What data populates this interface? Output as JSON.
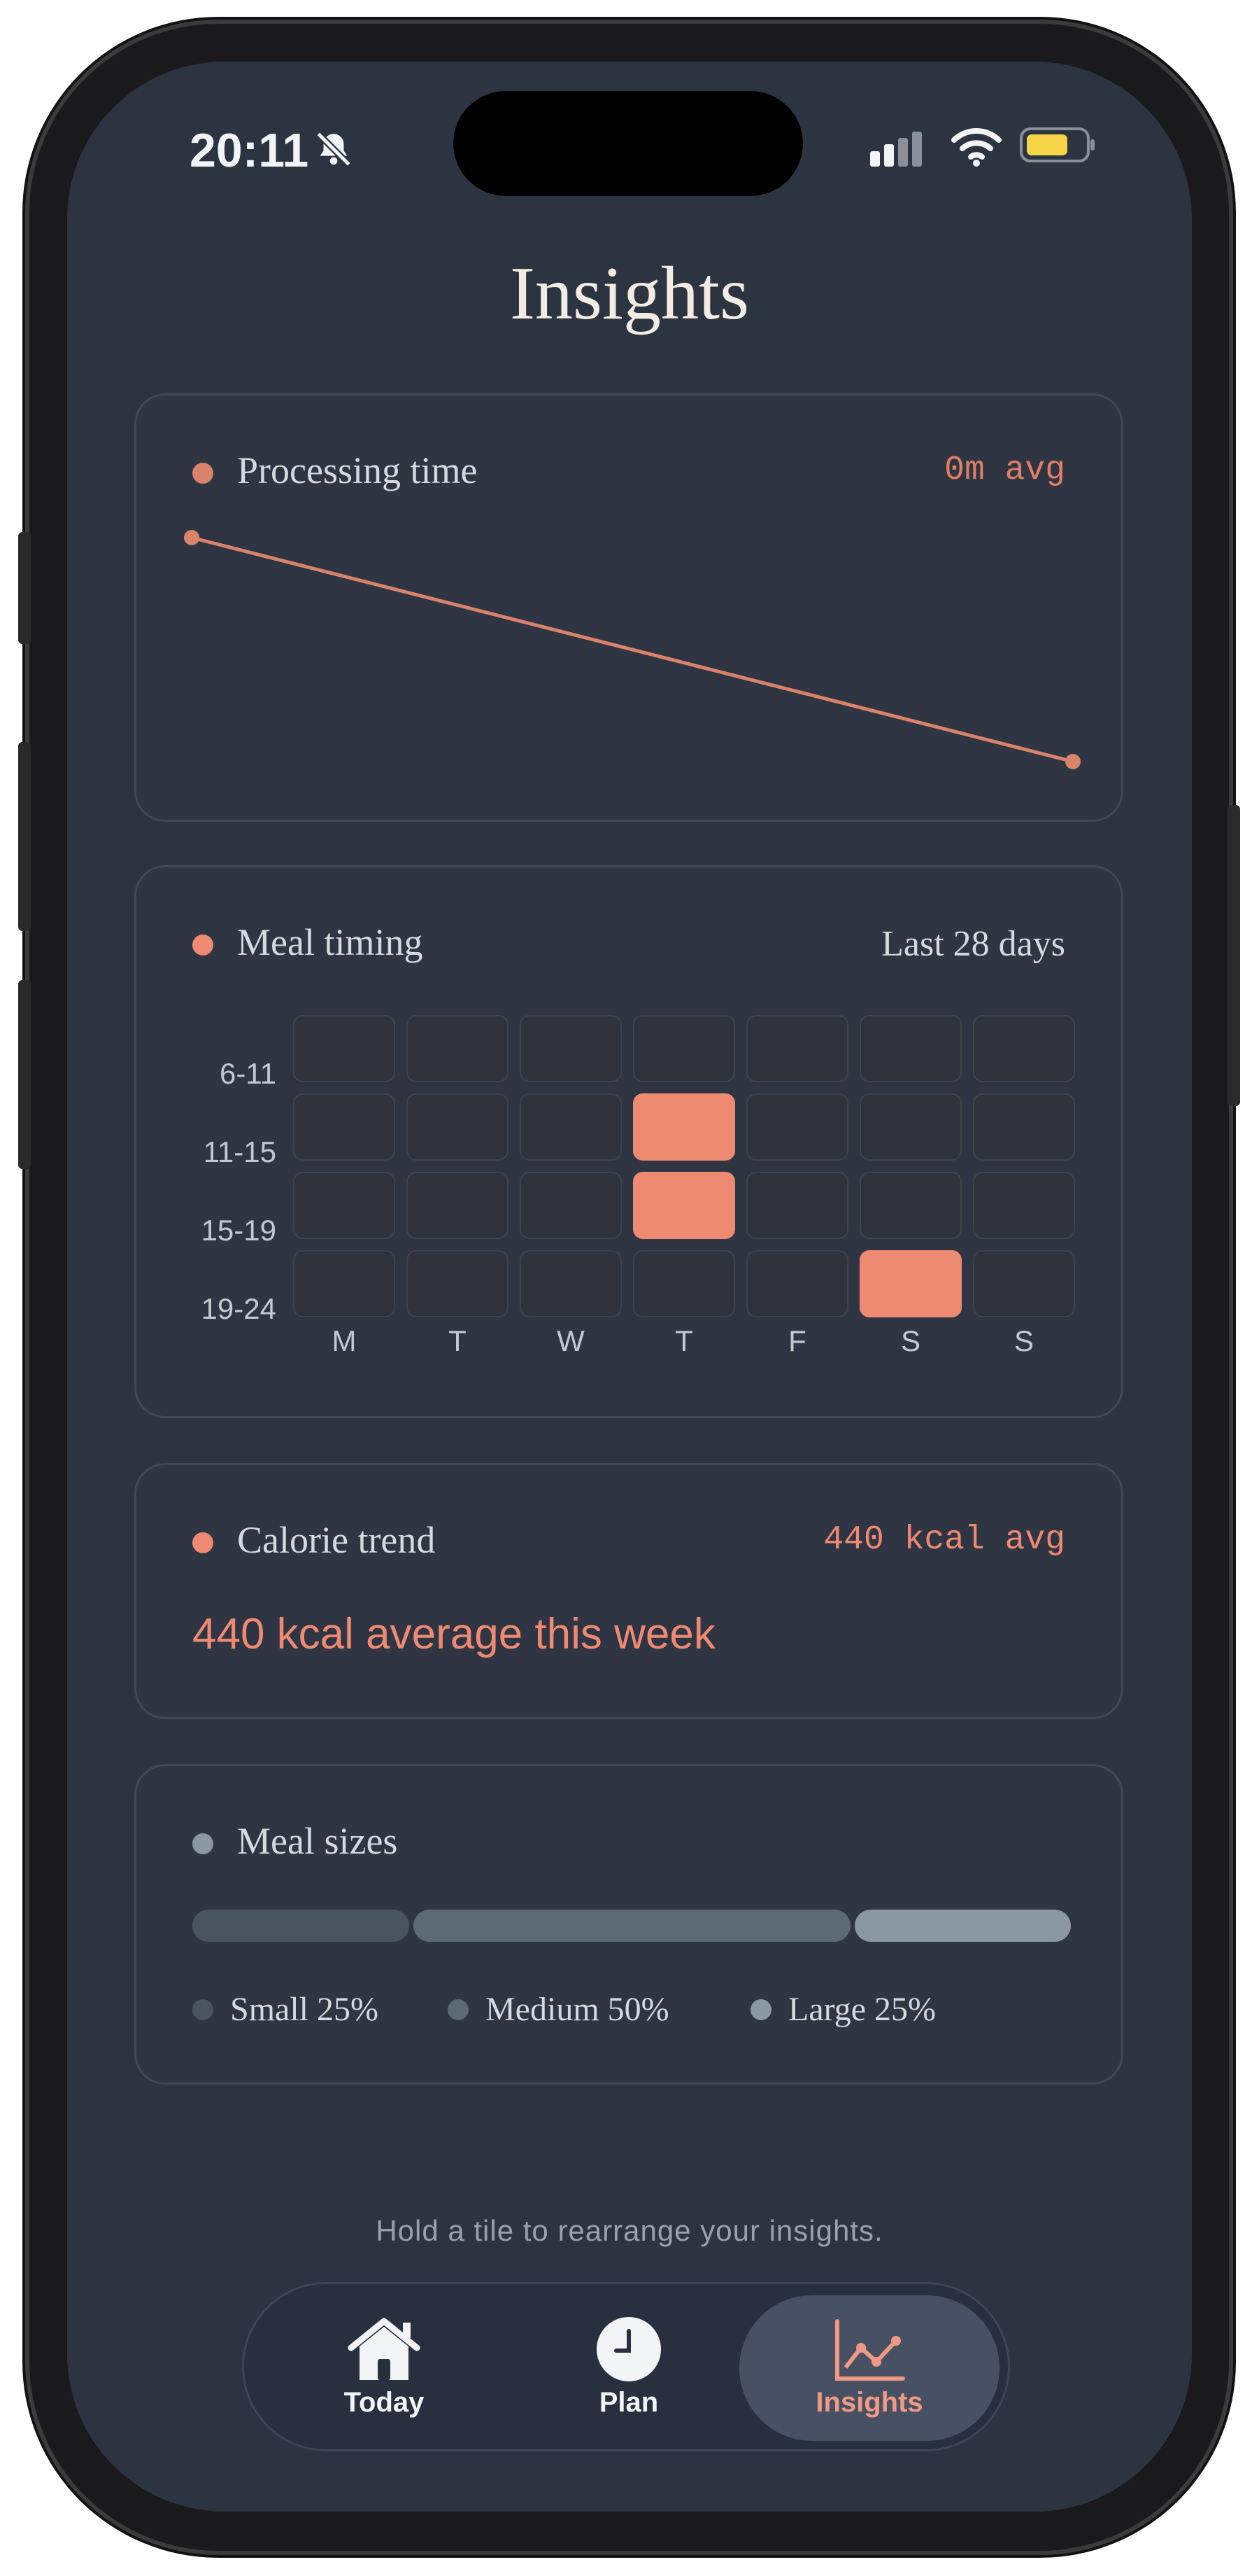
{
  "colors": {
    "background": "#2d3441",
    "card": "#2f3542",
    "accent": "#ef8a72",
    "accent_line": "#d9836b",
    "muted": "#8c97a4",
    "title": "#f2ece3"
  },
  "status_bar": {
    "time": "20:11",
    "icons": [
      "bell-slash-icon",
      "signal-icon",
      "wifi-icon",
      "battery-icon"
    ]
  },
  "page": {
    "title": "Insights"
  },
  "cards": {
    "processing": {
      "title": "Processing time",
      "meta": "0m avg",
      "chart_data": {
        "type": "line",
        "x": [
          0,
          1
        ],
        "values": [
          1,
          0
        ],
        "title": "Processing time",
        "xlabel": "",
        "ylabel": "",
        "grid": false
      }
    },
    "meal_timing": {
      "title": "Meal timing",
      "meta": "Last 28 days",
      "rows": [
        "6-11",
        "11-15",
        "15-19",
        "19-24"
      ],
      "cols": [
        "M",
        "T",
        "W",
        "T",
        "F",
        "S",
        "S"
      ],
      "active": [
        [
          0,
          0,
          0,
          0,
          0,
          0,
          0
        ],
        [
          0,
          0,
          0,
          1,
          0,
          0,
          0
        ],
        [
          0,
          0,
          0,
          1,
          0,
          0,
          0
        ],
        [
          0,
          0,
          0,
          0,
          0,
          1,
          0
        ]
      ]
    },
    "calorie": {
      "title": "Calorie trend",
      "meta": "440 kcal avg",
      "summary": "440 kcal average this week"
    },
    "meal_sizes": {
      "title": "Meal sizes",
      "segments": [
        {
          "label": "Small 25%",
          "fraction": 0.25,
          "color": "#4a5360"
        },
        {
          "label": "Medium 50%",
          "fraction": 0.5,
          "color": "#5d6975"
        },
        {
          "label": "Large 25%",
          "fraction": 0.25,
          "color": "#8c97a4"
        }
      ]
    }
  },
  "footer": {
    "hint": "Hold a tile to rearrange your insights."
  },
  "tabbar": {
    "tabs": [
      {
        "label": "Today",
        "icon": "house-icon"
      },
      {
        "label": "Plan",
        "icon": "clock-icon"
      },
      {
        "label": "Insights",
        "icon": "chart-icon",
        "active": true
      }
    ]
  }
}
